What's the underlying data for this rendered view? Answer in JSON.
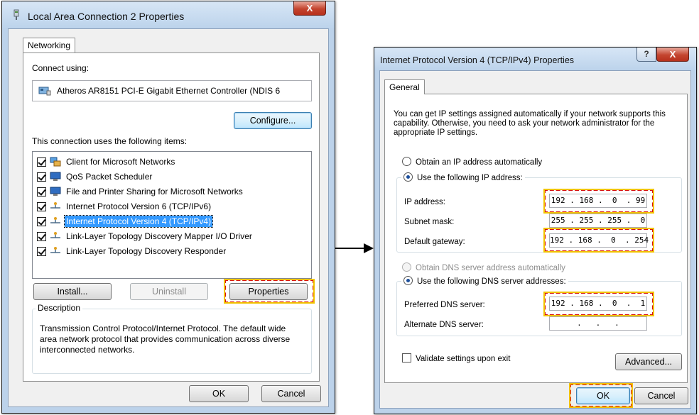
{
  "window1": {
    "title": "Local Area Connection 2 Properties",
    "close_glyph": "X",
    "tab": "Networking",
    "connect_using_label": "Connect using:",
    "adapter": "Atheros AR8151 PCI-E Gigabit Ethernet Controller (NDIS 6",
    "configure": "Configure...",
    "items_label": "This connection uses the following items:",
    "items": [
      {
        "label": "Client for Microsoft Networks",
        "checked": true,
        "icon": "network-client-icon"
      },
      {
        "label": "QoS Packet Scheduler",
        "checked": true,
        "icon": "computer-icon"
      },
      {
        "label": "File and Printer Sharing for Microsoft Networks",
        "checked": true,
        "icon": "computer-icon"
      },
      {
        "label": "Internet Protocol Version 6 (TCP/IPv6)",
        "checked": true,
        "icon": "protocol-icon"
      },
      {
        "label": "Internet Protocol Version 4 (TCP/IPv4)",
        "checked": true,
        "icon": "protocol-icon",
        "selected": true
      },
      {
        "label": "Link-Layer Topology Discovery Mapper I/O Driver",
        "checked": true,
        "icon": "protocol-icon"
      },
      {
        "label": "Link-Layer Topology Discovery Responder",
        "checked": true,
        "icon": "protocol-icon"
      }
    ],
    "install": "Install...",
    "uninstall": "Uninstall",
    "properties": "Properties",
    "description_title": "Description",
    "description": "Transmission Control Protocol/Internet Protocol. The default wide area network protocol that provides communication across diverse interconnected networks.",
    "ok": "OK",
    "cancel": "Cancel"
  },
  "window2": {
    "title": "Internet Protocol Version 4 (TCP/IPv4) Properties",
    "help_glyph": "?",
    "close_glyph": "X",
    "tab": "General",
    "intro": "You can get IP settings assigned automatically if your network supports this capability. Otherwise, you need to ask your network administrator for the appropriate IP settings.",
    "obtain_ip": "Obtain an IP address automatically",
    "use_ip": "Use the following IP address:",
    "ip_label": "IP address:",
    "ip_value": "192 . 168 .  0  . 99",
    "subnet_label": "Subnet mask:",
    "subnet_value": "255 . 255 . 255 .  0",
    "gateway_label": "Default gateway:",
    "gateway_value": "192 . 168 .  0  . 254",
    "obtain_dns": "Obtain DNS server address automatically",
    "use_dns": "Use the following DNS server addresses:",
    "preferred_label": "Preferred DNS server:",
    "preferred_value": "192 . 168 .  0  .  1",
    "alternate_label": "Alternate DNS server:",
    "alternate_value": " .   .   . ",
    "validate": "Validate settings upon exit",
    "advanced": "Advanced...",
    "ok": "OK",
    "cancel": "Cancel"
  },
  "colors": {
    "highlight_border": "#d7120f",
    "highlight_outline": "#f2c200",
    "selection": "#3399ff"
  }
}
